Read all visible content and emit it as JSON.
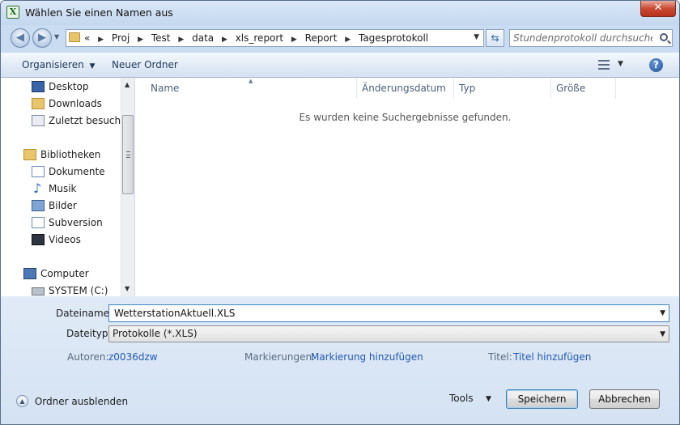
{
  "window": {
    "title": "Wählen Sie einen Namen aus",
    "app_icon": "excel-icon",
    "close_label": "✕"
  },
  "address": {
    "overflow": "«",
    "crumbs": [
      "Proj",
      "Test",
      "data",
      "xls_report",
      "Report",
      "Tagesprotokoll"
    ],
    "search_placeholder": "Stundenprotokoll durchsuchen"
  },
  "toolbar": {
    "organize_label": "Organisieren",
    "new_folder_label": "Neuer Ordner",
    "help_label": "?"
  },
  "sidebar": {
    "items": [
      {
        "label": "Desktop",
        "icon": "desktop-icon"
      },
      {
        "label": "Downloads",
        "icon": "downloads-folder-icon"
      },
      {
        "label": "Zuletzt besucht",
        "icon": "recent-places-icon"
      },
      {
        "label": "Bibliotheken",
        "icon": "libraries-icon"
      },
      {
        "label": "Dokumente",
        "icon": "documents-icon"
      },
      {
        "label": "Musik",
        "icon": "music-icon"
      },
      {
        "label": "Bilder",
        "icon": "pictures-icon"
      },
      {
        "label": "Subversion",
        "icon": "subversion-icon"
      },
      {
        "label": "Videos",
        "icon": "videos-icon"
      },
      {
        "label": "Computer",
        "icon": "computer-icon"
      },
      {
        "label": "SYSTEM (C:)",
        "icon": "drive-icon"
      }
    ]
  },
  "filelist": {
    "columns": [
      "Name",
      "Änderungsdatum",
      "Typ",
      "Größe"
    ],
    "empty_message": "Es wurden keine Suchergebnisse gefunden."
  },
  "form": {
    "filename_label": "Dateiname:",
    "filename_value": "WetterstationAktuell.XLS",
    "filetype_label": "Dateityp:",
    "filetype_value": "Protokolle (*.XLS)",
    "authors_label": "Autoren:",
    "authors_value": "z0036dzw",
    "tags_label": "Markierungen:",
    "tags_value": "Markierung hinzufügen",
    "title_label": "Titel:",
    "title_value": "Titel hinzufügen"
  },
  "footer": {
    "hide_folders_label": "Ordner ausblenden",
    "tools_label": "Tools",
    "save_label": "Speichern",
    "cancel_label": "Abbrechen"
  }
}
